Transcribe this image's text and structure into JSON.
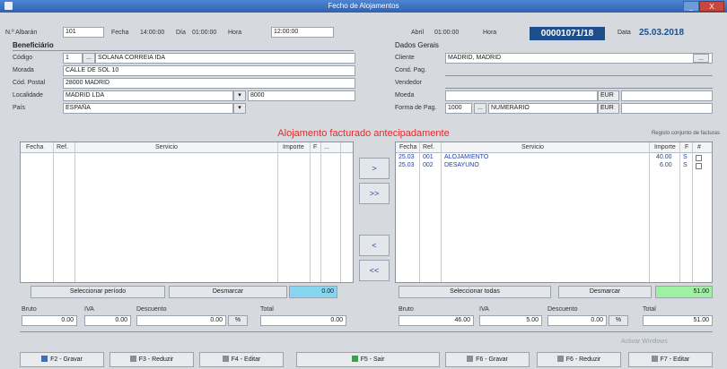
{
  "window": {
    "title": "Fecho de Alojamentos",
    "minimize": "_",
    "close": "X"
  },
  "top": {
    "albaran_label": "N.º Albarán",
    "albaran_value": "101",
    "t1": "Fecha",
    "t2": "14:00:00",
    "t3": "Día",
    "t4": "01:00:00",
    "t5": "Hora",
    "t6": "12:00:00",
    "t7": "Abril",
    "t8": "01:00:00",
    "t9": "Hora",
    "doc_number": "00001071/18",
    "t10": "Data",
    "date": "25.03.2018"
  },
  "left_group": {
    "title": "Beneficiário",
    "rows": [
      {
        "label": "Código",
        "value": "1",
        "extra": "SOLANA CORREIA IDA"
      },
      {
        "label": "Morada",
        "value": "CALLE DE SOL 10"
      },
      {
        "label": "Cód. Postal",
        "value": "28000 MADRID"
      },
      {
        "label": "Localidade",
        "value": "MADRID LDA",
        "extra": "8000"
      },
      {
        "label": "País",
        "value": "ESPAÑA"
      }
    ]
  },
  "right_group": {
    "title": "Dados Gerais",
    "rows": [
      {
        "label": "Cliente",
        "value": "MADRID, MADRID"
      },
      {
        "label": "Cond. Pag.",
        "value": ""
      },
      {
        "label": "Vendedor",
        "value": ""
      },
      {
        "label": "Moeda",
        "value": "EUR"
      },
      {
        "label": "Forma de Pag.",
        "value": "1000",
        "extra": "NUMERÁRIO",
        "code": "EUR"
      }
    ]
  },
  "warning": "Alojamento facturado antecipadamente",
  "warning_right": "Registo conjunto de facturas",
  "left_grid": {
    "headers": [
      "Fecha",
      "Ref.",
      "Servicio",
      "Importe",
      "F",
      "..."
    ]
  },
  "right_grid": {
    "headers": [
      "Fecha",
      "Ref.",
      "Servicio",
      "Importe",
      "F",
      "#"
    ],
    "rows": [
      {
        "fecha": "25.03",
        "ref": "001",
        "servicio": "ALOJAMIENTO",
        "importe": "40.00",
        "f": "S"
      },
      {
        "fecha": "25.03",
        "ref": "002",
        "servicio": "DESAYUNO",
        "importe": "6.00",
        "f": "S"
      }
    ]
  },
  "transfer_buttons": [
    ">",
    ">>",
    "<",
    "<<"
  ],
  "summary_left": {
    "btn1": "Seleccionar período",
    "btn2": "Desmarcar",
    "value": "0.00"
  },
  "summary_right": {
    "btn1": "Seleccionar todas",
    "btn2": "Desmarcar",
    "value": "51.00"
  },
  "footer_left": [
    {
      "label": "Bruto",
      "value": "0.00"
    },
    {
      "label": "IVA",
      "value": "0.00"
    },
    {
      "label": "Descuento",
      "value": "0.00"
    },
    {
      "label": "Total",
      "value": "0.00"
    }
  ],
  "footer_right": [
    {
      "label": "Bruto",
      "value": "46.00"
    },
    {
      "label": "IVA",
      "value": "5.00"
    },
    {
      "label": "Descuento",
      "value": "0.00"
    },
    {
      "label": "Total",
      "value": "51.00"
    }
  ],
  "status_text": "Activar Windows",
  "buttons": [
    {
      "label": "F2 - Gravar",
      "icon": "save-icon"
    },
    {
      "label": "F3 - Reduzir",
      "icon": "reduce-icon"
    },
    {
      "label": "F4 - Editar",
      "icon": "edit-icon"
    },
    {
      "label": "F5 - Sair",
      "icon": "exit-icon"
    },
    {
      "label": "F6 - Gravar",
      "icon": "save-icon"
    },
    {
      "label": "F6 - Reduzir",
      "icon": "reduce-icon"
    },
    {
      "label": "F7 - Editar",
      "icon": "edit-icon"
    }
  ],
  "colors": {
    "accent": "#1f4e8c",
    "warning": "#e32b2b",
    "left_total": "#86d6f2",
    "right_total": "#9ef0a2"
  }
}
